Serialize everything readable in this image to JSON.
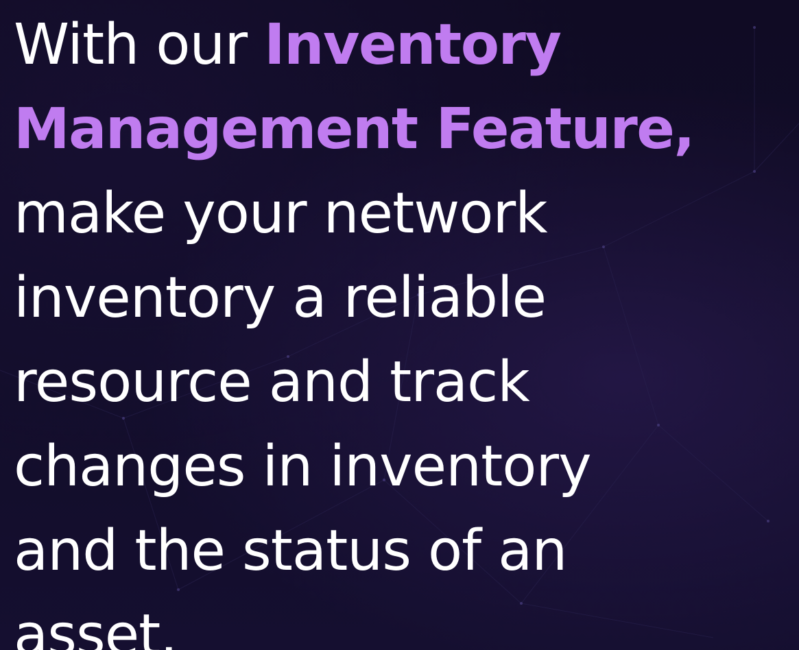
{
  "headline": {
    "line1_prefix": "With our ",
    "line1_highlight": "Inventory",
    "line2_highlight": "Management Feature,",
    "line3": "make your network",
    "line4": "inventory a reliable",
    "line5": "resource and track",
    "line6": "changes in inventory",
    "line7": "and the status of an",
    "line8": "asset."
  },
  "colors": {
    "background": "#0f0b22",
    "text": "#ffffff",
    "highlight": "#c07cf0",
    "network_lines": "#2a2350"
  }
}
